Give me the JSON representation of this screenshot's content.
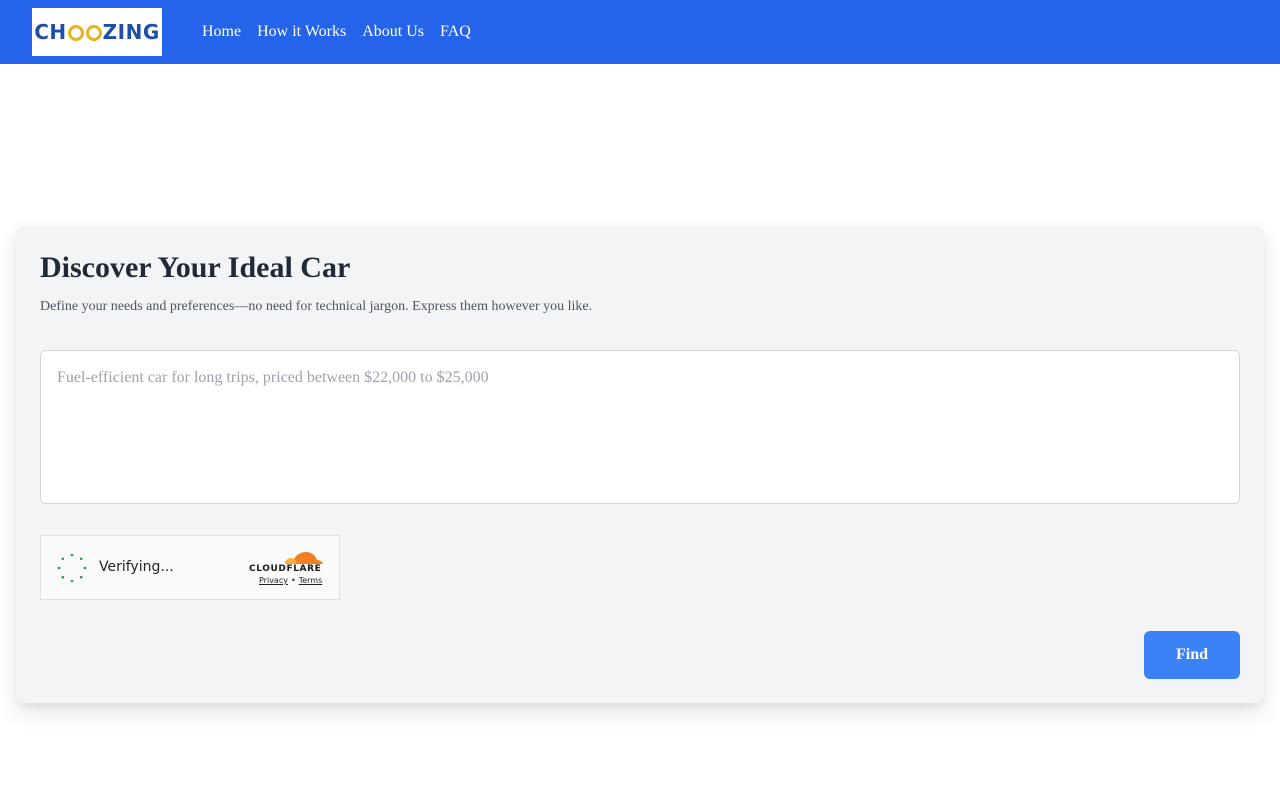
{
  "nav": {
    "logo_text": "CHOOZING",
    "links": [
      "Home",
      "How it Works",
      "About Us",
      "FAQ"
    ]
  },
  "main": {
    "title": "Discover Your Ideal Car",
    "subtitle": "Define your needs and preferences—no need for technical jargon. Express them however you like.",
    "query": {
      "value": "",
      "placeholder": "Fuel-efficient car for long trips, priced between $22,000 to $25,000"
    },
    "find_label": "Find"
  },
  "captcha": {
    "status": "Verifying...",
    "brand": "CLOUDFLARE",
    "privacy_label": "Privacy",
    "separator": "•",
    "terms_label": "Terms"
  },
  "colors": {
    "nav_bg": "#2563eb",
    "card_bg": "#f3f4f6",
    "button_bg": "#3b82f6",
    "spinner": "#22a153",
    "cloudflare_orange": "#f38020"
  }
}
